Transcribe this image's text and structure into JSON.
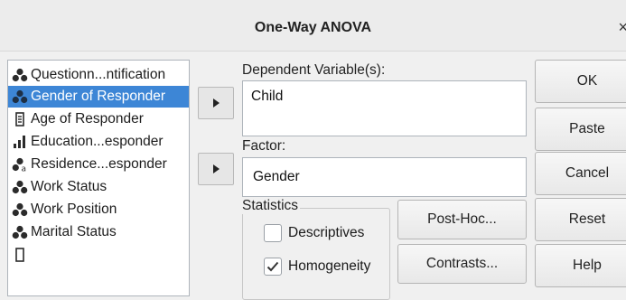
{
  "dialog": {
    "title": "One-Way ANOVA",
    "close_glyph": "×"
  },
  "variables": [
    {
      "label": "Questionn...ntification",
      "icon": "nominal-icon",
      "selected": false
    },
    {
      "label": "Gender of Responder",
      "icon": "nominal-icon",
      "selected": true
    },
    {
      "label": "Age of Responder",
      "icon": "scale-icon",
      "selected": false
    },
    {
      "label": "Education...esponder",
      "icon": "ordinal-icon",
      "selected": false
    },
    {
      "label": "Residence...esponder",
      "icon": "nominal-string-icon",
      "selected": false
    },
    {
      "label": "Work Status",
      "icon": "nominal-icon",
      "selected": false
    },
    {
      "label": "Work Position",
      "icon": "nominal-icon",
      "selected": false
    },
    {
      "label": "Marital Status",
      "icon": "nominal-icon",
      "selected": false
    }
  ],
  "dependent": {
    "label": "Dependent Variable(s):",
    "value": "Child"
  },
  "factor": {
    "label": "Factor:",
    "value": "Gender"
  },
  "statistics": {
    "legend": "Statistics",
    "descriptives": {
      "label": "Descriptives",
      "checked": false
    },
    "homogeneity": {
      "label": "Homogeneity",
      "checked": true
    }
  },
  "buttons": {
    "post_hoc": "Post-Hoc...",
    "contrasts": "Contrasts...",
    "ok": "OK",
    "paste": "Paste",
    "cancel": "Cancel",
    "reset": "Reset",
    "help": "Help"
  },
  "colors": {
    "selection": "#3d86d6",
    "nominal_icon": "#2b2b2b"
  }
}
